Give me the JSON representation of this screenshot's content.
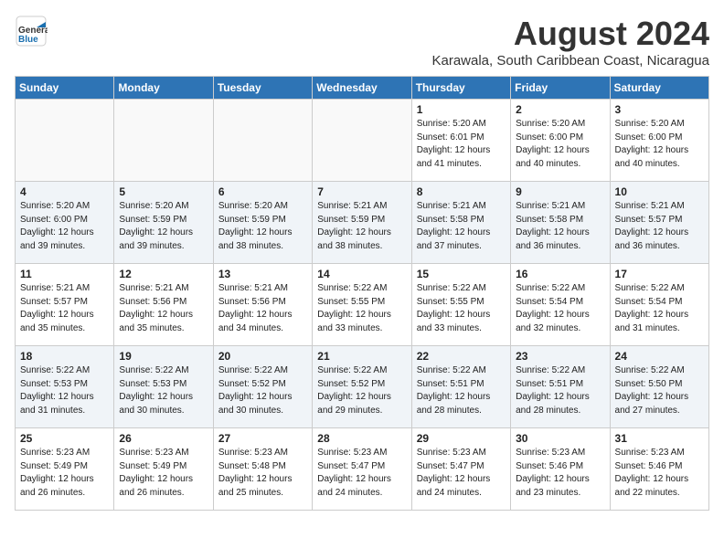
{
  "header": {
    "logo_general": "General",
    "logo_blue": "Blue",
    "title": "August 2024",
    "location": "Karawala, South Caribbean Coast, Nicaragua"
  },
  "days_of_week": [
    "Sunday",
    "Monday",
    "Tuesday",
    "Wednesday",
    "Thursday",
    "Friday",
    "Saturday"
  ],
  "weeks": [
    [
      {
        "num": "",
        "info": ""
      },
      {
        "num": "",
        "info": ""
      },
      {
        "num": "",
        "info": ""
      },
      {
        "num": "",
        "info": ""
      },
      {
        "num": "1",
        "info": "Sunrise: 5:20 AM\nSunset: 6:01 PM\nDaylight: 12 hours\nand 41 minutes."
      },
      {
        "num": "2",
        "info": "Sunrise: 5:20 AM\nSunset: 6:00 PM\nDaylight: 12 hours\nand 40 minutes."
      },
      {
        "num": "3",
        "info": "Sunrise: 5:20 AM\nSunset: 6:00 PM\nDaylight: 12 hours\nand 40 minutes."
      }
    ],
    [
      {
        "num": "4",
        "info": "Sunrise: 5:20 AM\nSunset: 6:00 PM\nDaylight: 12 hours\nand 39 minutes."
      },
      {
        "num": "5",
        "info": "Sunrise: 5:20 AM\nSunset: 5:59 PM\nDaylight: 12 hours\nand 39 minutes."
      },
      {
        "num": "6",
        "info": "Sunrise: 5:20 AM\nSunset: 5:59 PM\nDaylight: 12 hours\nand 38 minutes."
      },
      {
        "num": "7",
        "info": "Sunrise: 5:21 AM\nSunset: 5:59 PM\nDaylight: 12 hours\nand 38 minutes."
      },
      {
        "num": "8",
        "info": "Sunrise: 5:21 AM\nSunset: 5:58 PM\nDaylight: 12 hours\nand 37 minutes."
      },
      {
        "num": "9",
        "info": "Sunrise: 5:21 AM\nSunset: 5:58 PM\nDaylight: 12 hours\nand 36 minutes."
      },
      {
        "num": "10",
        "info": "Sunrise: 5:21 AM\nSunset: 5:57 PM\nDaylight: 12 hours\nand 36 minutes."
      }
    ],
    [
      {
        "num": "11",
        "info": "Sunrise: 5:21 AM\nSunset: 5:57 PM\nDaylight: 12 hours\nand 35 minutes."
      },
      {
        "num": "12",
        "info": "Sunrise: 5:21 AM\nSunset: 5:56 PM\nDaylight: 12 hours\nand 35 minutes."
      },
      {
        "num": "13",
        "info": "Sunrise: 5:21 AM\nSunset: 5:56 PM\nDaylight: 12 hours\nand 34 minutes."
      },
      {
        "num": "14",
        "info": "Sunrise: 5:22 AM\nSunset: 5:55 PM\nDaylight: 12 hours\nand 33 minutes."
      },
      {
        "num": "15",
        "info": "Sunrise: 5:22 AM\nSunset: 5:55 PM\nDaylight: 12 hours\nand 33 minutes."
      },
      {
        "num": "16",
        "info": "Sunrise: 5:22 AM\nSunset: 5:54 PM\nDaylight: 12 hours\nand 32 minutes."
      },
      {
        "num": "17",
        "info": "Sunrise: 5:22 AM\nSunset: 5:54 PM\nDaylight: 12 hours\nand 31 minutes."
      }
    ],
    [
      {
        "num": "18",
        "info": "Sunrise: 5:22 AM\nSunset: 5:53 PM\nDaylight: 12 hours\nand 31 minutes."
      },
      {
        "num": "19",
        "info": "Sunrise: 5:22 AM\nSunset: 5:53 PM\nDaylight: 12 hours\nand 30 minutes."
      },
      {
        "num": "20",
        "info": "Sunrise: 5:22 AM\nSunset: 5:52 PM\nDaylight: 12 hours\nand 30 minutes."
      },
      {
        "num": "21",
        "info": "Sunrise: 5:22 AM\nSunset: 5:52 PM\nDaylight: 12 hours\nand 29 minutes."
      },
      {
        "num": "22",
        "info": "Sunrise: 5:22 AM\nSunset: 5:51 PM\nDaylight: 12 hours\nand 28 minutes."
      },
      {
        "num": "23",
        "info": "Sunrise: 5:22 AM\nSunset: 5:51 PM\nDaylight: 12 hours\nand 28 minutes."
      },
      {
        "num": "24",
        "info": "Sunrise: 5:22 AM\nSunset: 5:50 PM\nDaylight: 12 hours\nand 27 minutes."
      }
    ],
    [
      {
        "num": "25",
        "info": "Sunrise: 5:23 AM\nSunset: 5:49 PM\nDaylight: 12 hours\nand 26 minutes."
      },
      {
        "num": "26",
        "info": "Sunrise: 5:23 AM\nSunset: 5:49 PM\nDaylight: 12 hours\nand 26 minutes."
      },
      {
        "num": "27",
        "info": "Sunrise: 5:23 AM\nSunset: 5:48 PM\nDaylight: 12 hours\nand 25 minutes."
      },
      {
        "num": "28",
        "info": "Sunrise: 5:23 AM\nSunset: 5:47 PM\nDaylight: 12 hours\nand 24 minutes."
      },
      {
        "num": "29",
        "info": "Sunrise: 5:23 AM\nSunset: 5:47 PM\nDaylight: 12 hours\nand 24 minutes."
      },
      {
        "num": "30",
        "info": "Sunrise: 5:23 AM\nSunset: 5:46 PM\nDaylight: 12 hours\nand 23 minutes."
      },
      {
        "num": "31",
        "info": "Sunrise: 5:23 AM\nSunset: 5:46 PM\nDaylight: 12 hours\nand 22 minutes."
      }
    ]
  ]
}
